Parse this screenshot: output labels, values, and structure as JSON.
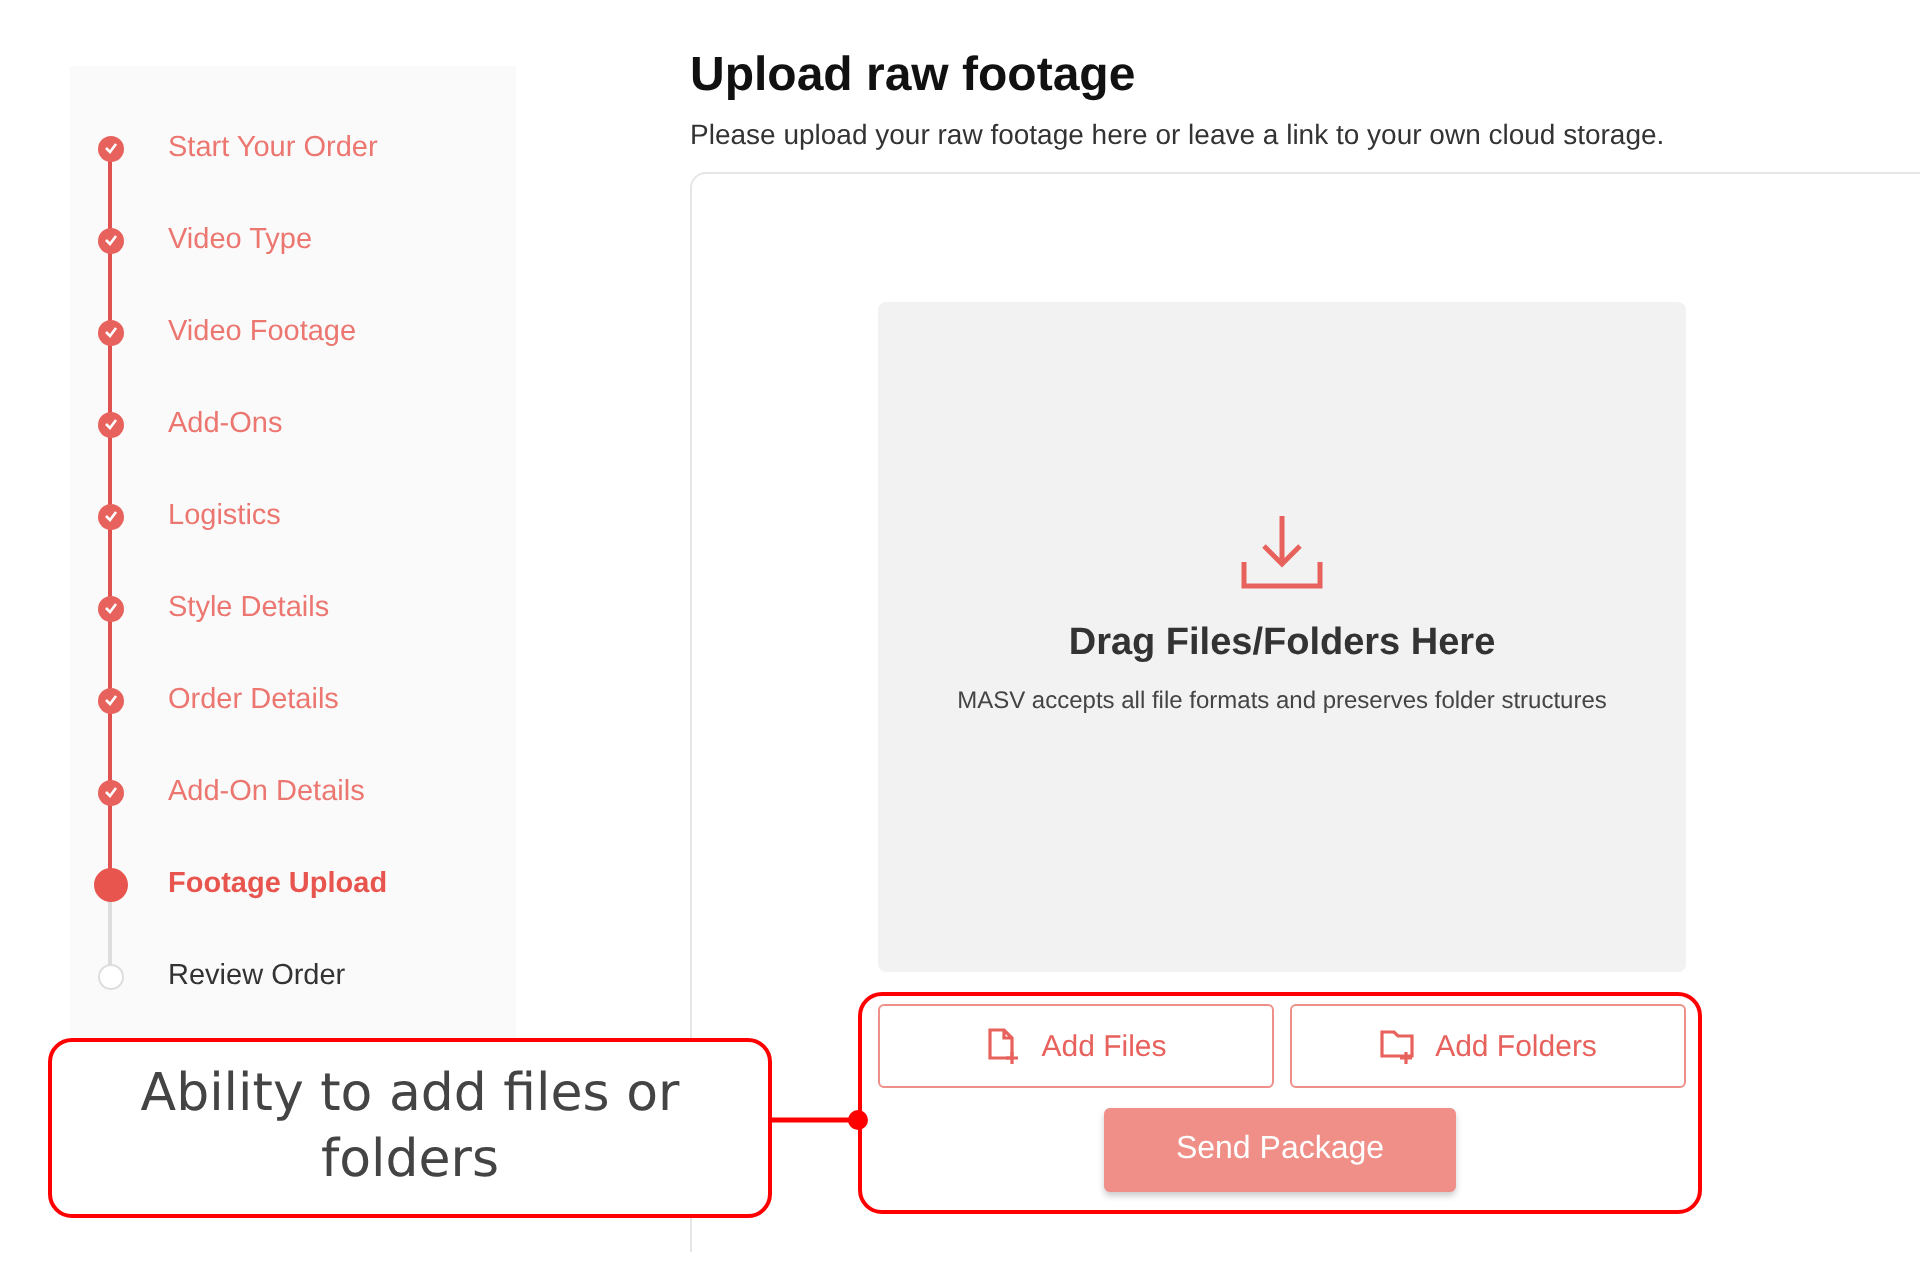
{
  "steps": [
    {
      "label": "Start Your Order",
      "completed": true,
      "selected": false
    },
    {
      "label": "Video Type",
      "completed": true,
      "selected": false
    },
    {
      "label": "Video Footage",
      "completed": true,
      "selected": false
    },
    {
      "label": "Add-Ons",
      "completed": true,
      "selected": false
    },
    {
      "label": "Logistics",
      "completed": true,
      "selected": false
    },
    {
      "label": "Style Details",
      "completed": true,
      "selected": false
    },
    {
      "label": "Order Details",
      "completed": true,
      "selected": false
    },
    {
      "label": "Add-On Details",
      "completed": true,
      "selected": false
    },
    {
      "label": "Footage Upload",
      "completed": false,
      "selected": true
    },
    {
      "label": "Review Order",
      "completed": false,
      "selected": false
    }
  ],
  "upload": {
    "title": "Upload raw footage",
    "subtitle": "Please upload your raw footage here or leave a link to your own cloud storage.",
    "drop_title": "Drag Files/Folders Here",
    "drop_note": "MASV accepts all file formats and preserves folder structures",
    "buttons": [
      {
        "kind": "file",
        "label": "Add Files"
      },
      {
        "kind": "folder",
        "label": "Add Folders"
      }
    ],
    "send": {
      "label": "Send Package",
      "disabled": true
    }
  },
  "callout": {
    "text": "Ability to add files or folders"
  }
}
